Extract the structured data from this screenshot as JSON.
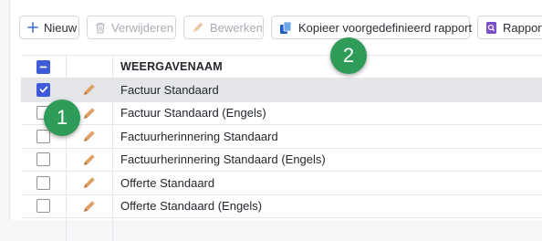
{
  "toolbar": {
    "new_label": "Nieuw",
    "delete_label": "Verwijderen",
    "edit_label": "Bewerken",
    "copy_label": "Kopieer voorgedefinieerd rapport",
    "report_label": "Rapport"
  },
  "table": {
    "column_header": "WEERGAVENAAM",
    "rows": [
      {
        "name": "Factuur Standaard",
        "checked": true
      },
      {
        "name": "Factuur Standaard (Engels)",
        "checked": false
      },
      {
        "name": "Factuurherinnering Standaard",
        "checked": false
      },
      {
        "name": "Factuurherinnering Standaard (Engels)",
        "checked": false
      },
      {
        "name": "Offerte Standaard",
        "checked": false
      },
      {
        "name": "Offerte Standaard (Engels)",
        "checked": false
      },
      {
        "name": "",
        "checked": false
      }
    ]
  },
  "annotations": {
    "badge_1": "1",
    "badge_2": "2"
  },
  "colors": {
    "accent": "#3d5bd9",
    "pencil": "#e0a065",
    "badge": "#2e9c58"
  }
}
